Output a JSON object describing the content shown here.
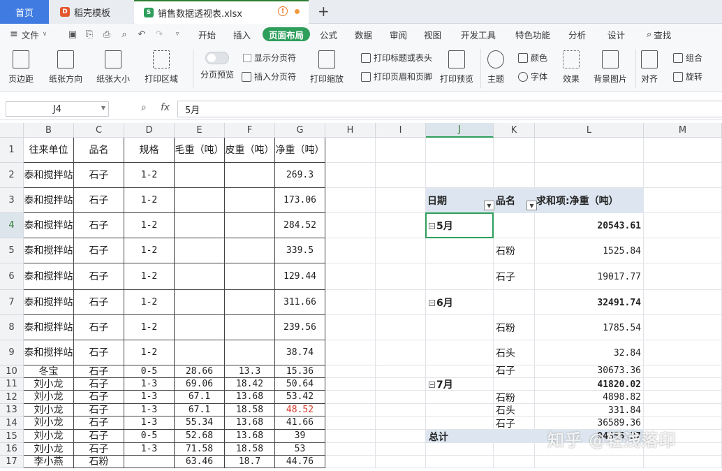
{
  "tabs": {
    "home": "首页",
    "template": "稻壳模板",
    "file": "销售数据透视表.xlsx",
    "file_icon": "S",
    "template_icon": "D"
  },
  "menu": {
    "file": "文件",
    "items": [
      "开始",
      "插入",
      "页面布局",
      "公式",
      "数据",
      "审阅",
      "视图",
      "开发工具",
      "特色功能",
      "分析",
      "设计"
    ],
    "active_index": 2,
    "search": "查找"
  },
  "ribbon": {
    "margins": "页边距",
    "orientation": "纸张方向",
    "size": "纸张大小",
    "print_area": "打印区域",
    "page_break_preview": "分页预览",
    "show_page_break": "显示分页符",
    "insert_page_break": "插入分页符",
    "print_scale": "打印缩放",
    "print_titles": "打印标题或表头",
    "print_header_footer": "打印页眉和页脚",
    "print_preview": "打印预览",
    "theme": "主题",
    "colors": "颜色",
    "fonts": "字体",
    "effects": "效果",
    "background": "背景图片",
    "align": "对齐",
    "group": "组合",
    "rotate": "旋转"
  },
  "formula_bar": {
    "name_box": "J4",
    "fx": "fx",
    "value": "5月"
  },
  "columns": [
    "B",
    "C",
    "D",
    "E",
    "F",
    "G",
    "H",
    "I",
    "J",
    "K",
    "L",
    "M"
  ],
  "selected_column": "J",
  "rows": [
    "1",
    "2",
    "3",
    "4",
    "5",
    "6",
    "7",
    "8",
    "9",
    "10",
    "11",
    "12",
    "13",
    "14",
    "15",
    "16",
    "17"
  ],
  "selected_row": "4",
  "table": {
    "headers": [
      "往来单位",
      "品名",
      "规格",
      "毛重（吨）",
      "皮重（吨）",
      "净重（吨）"
    ],
    "rows": [
      [
        "泰和搅拌站",
        "石子",
        "1-2",
        "",
        "",
        "269.3"
      ],
      [
        "泰和搅拌站",
        "石子",
        "1-2",
        "",
        "",
        "173.06"
      ],
      [
        "泰和搅拌站",
        "石子",
        "1-2",
        "",
        "",
        "284.52"
      ],
      [
        "泰和搅拌站",
        "石子",
        "1-2",
        "",
        "",
        "339.5"
      ],
      [
        "泰和搅拌站",
        "石子",
        "1-2",
        "",
        "",
        "129.44"
      ],
      [
        "泰和搅拌站",
        "石子",
        "1-2",
        "",
        "",
        "311.66"
      ],
      [
        "泰和搅拌站",
        "石子",
        "1-2",
        "",
        "",
        "239.56"
      ],
      [
        "泰和搅拌站",
        "石子",
        "1-2",
        "",
        "",
        "38.74"
      ],
      [
        "冬宝",
        "石子",
        "0-5",
        "28.66",
        "13.3",
        "15.36"
      ],
      [
        "刘小龙",
        "石子",
        "1-3",
        "69.06",
        "18.42",
        "50.64"
      ],
      [
        "刘小龙",
        "石子",
        "1-3",
        "67.1",
        "13.68",
        "53.42"
      ],
      [
        "刘小龙",
        "石子",
        "1-3",
        "67.1",
        "18.58",
        "48.52"
      ],
      [
        "刘小龙",
        "石子",
        "1-3",
        "55.34",
        "13.68",
        "41.66"
      ],
      [
        "刘小龙",
        "石子",
        "0-5",
        "52.68",
        "13.68",
        "39"
      ],
      [
        "刘小龙",
        "石子",
        "1-3",
        "71.58",
        "18.58",
        "53"
      ],
      [
        "李小燕",
        "石粉",
        "",
        "63.46",
        "18.7",
        "44.76"
      ]
    ],
    "red_cell_color": "#d23b2b"
  },
  "pivot": {
    "h_date": "日期",
    "h_product": "品名",
    "h_sum": "求和项:净重（吨）",
    "may": "5月",
    "may_total": "20543.61",
    "may_1_name": "石粉",
    "may_1_val": "1525.84",
    "may_2_name": "石子",
    "may_2_val": "19017.77",
    "jun": "6月",
    "jun_total": "32491.74",
    "jun_1_name": "石粉",
    "jun_1_val": "1785.54",
    "jun_2_name": "石头",
    "jun_2_val": "32.84",
    "jun_3_name": "石子",
    "jun_3_val": "30673.36",
    "jul": "7月",
    "jul_total": "41820.02",
    "jul_1_name": "石粉",
    "jul_1_val": "4898.82",
    "jul_2_name": "石头",
    "jul_2_val": "331.84",
    "jul_3_name": "石子",
    "jul_3_val": "36589.36",
    "grand_label": "总计",
    "grand_total": "94855.37",
    "collapse_glyph": "−",
    "filter_glyph": "▼"
  },
  "watermark": "知乎 @轻浅落印",
  "colors": {
    "accent": "#2e9e5b",
    "home_tab": "#3f7be0",
    "pivot_band": "#dde6f0"
  }
}
